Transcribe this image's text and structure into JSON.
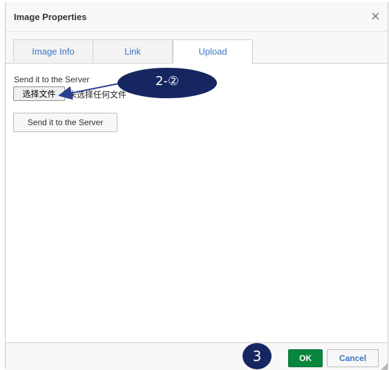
{
  "dialog": {
    "title": "Image Properties",
    "close_symbol": "×"
  },
  "tabs": [
    {
      "label": "Image Info",
      "active": false
    },
    {
      "label": "Link",
      "active": false
    },
    {
      "label": "Upload",
      "active": true
    }
  ],
  "upload": {
    "label": "Send it to the Server",
    "file_button": "选择文件",
    "file_status": "未选择任何文件",
    "send_button": "Send it to the Server"
  },
  "footer": {
    "ok_label": "OK",
    "cancel_label": "Cancel"
  },
  "annotations": {
    "step_a": "2-②",
    "step_b": "3"
  },
  "colors": {
    "accent": "#3a77c4",
    "ok_green": "#09863e",
    "annotation_navy": "#162660"
  },
  "icons": {
    "close": "close-icon",
    "resize": "resize-handle-icon"
  }
}
